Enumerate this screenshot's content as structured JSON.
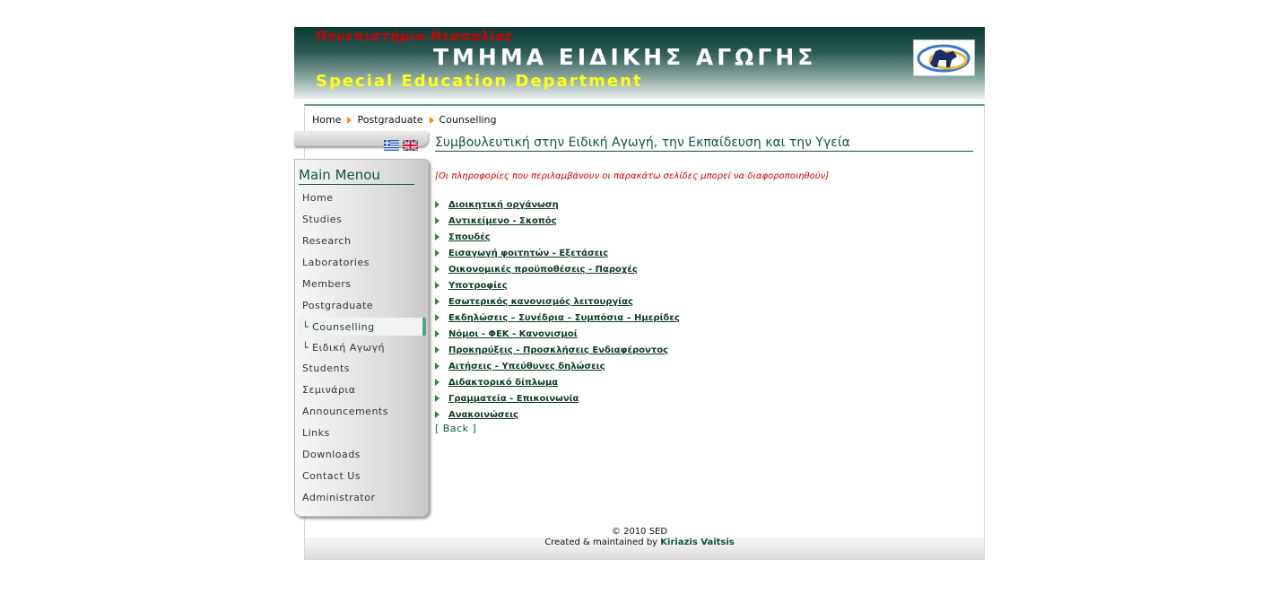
{
  "banner": {
    "university": "Πανεπιστήμιο Θεσσαλίας",
    "greek_title": "ΤΜΗΜΑ ΕΙΔΙΚΗΣ ΑΓΩΓΗΣ",
    "english_title": "Special Education Department"
  },
  "breadcrumb": [
    "Home",
    "Postgraduate",
    "Counselling"
  ],
  "menu": {
    "title": "Main Menou",
    "items": [
      {
        "label": "Home",
        "active": false
      },
      {
        "label": "Studies",
        "active": false
      },
      {
        "label": "Research",
        "active": false
      },
      {
        "label": "Laboratories",
        "active": false
      },
      {
        "label": "Members",
        "active": false
      },
      {
        "label": "Postgraduate",
        "active": false
      },
      {
        "label": "└ Counselling",
        "active": true
      },
      {
        "label": "└ Ειδική Αγωγή",
        "active": false
      },
      {
        "label": "Students",
        "active": false
      },
      {
        "label": "Σεμινάρια",
        "active": false
      },
      {
        "label": "Announcements",
        "active": false
      },
      {
        "label": "Links",
        "active": false
      },
      {
        "label": "Downloads",
        "active": false
      },
      {
        "label": "Contact Us",
        "active": false
      },
      {
        "label": "Administrator",
        "active": false
      }
    ]
  },
  "content": {
    "title": "Συμβουλευτική στην Ειδική Αγωγή, την Εκπαίδευση και την Υγεία",
    "notice": "[Οι πληροφορίες που περιλαμβάνουν οι παρακάτω σελίδες μπορεί να διαφοροποιηθούν]",
    "links": [
      "Διοικητική οργάνωση",
      "Αντικείμενο - Σκοπός",
      "Σπουδές",
      "Εισαγωγή φοιτητών - Εξετάσεις",
      "Οικονομικές προϋποθέσεις - Παροχές",
      "Υποτροφίες",
      "Εσωτερικός κανονισμός λειτουργίας",
      "Εκδηλώσεις – Συνέδρια – Συμπόσια – Ημερίδες",
      "Νόμοι - ΦΕΚ - Κανονισμοί",
      "Προκηρύξεις - Προσκλήσεις Ενδιαφέροντος",
      "Αιτήσεις - Υπεύθυνες δηλώσεις",
      "Διδακτορικό δίπλωμα",
      "Γραμματεία - Επικοινωνία",
      "Ανακοινώσεις"
    ],
    "back": "[ Back ]"
  },
  "footer": {
    "copyright": "© 2010 SED",
    "credits_prefix": "Created & maintained by",
    "author": "Kiriazis Vaitsis"
  },
  "colors": {
    "accent": "#0d5543",
    "notice": "#d10000",
    "banner_dark": "#0a3a32",
    "breadcrumb_arrow": "#ff8a00",
    "link_arrow": "#2d8a3a"
  },
  "icons": [
    "greek-flag-icon",
    "uk-flag-icon",
    "university-logo"
  ]
}
